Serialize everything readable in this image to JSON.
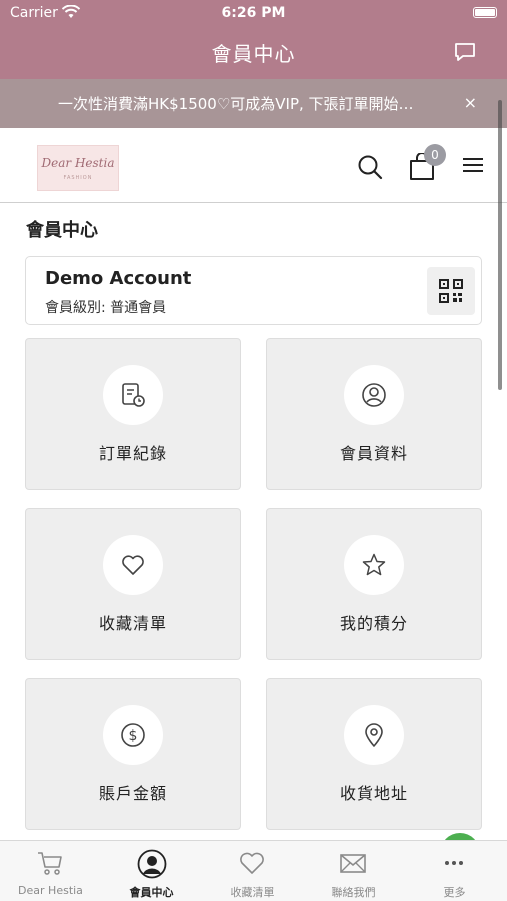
{
  "status_bar": {
    "carrier": "Carrier",
    "time": "6:26 PM"
  },
  "nav": {
    "title": "會員中心"
  },
  "announcement": {
    "text": "一次性消費滿HK$1500♡可成為VIP, 下張訂單開始…",
    "close": "×"
  },
  "header": {
    "logo_text": "Dear Hestia",
    "logo_sub": "FASHION",
    "cart_count": "0"
  },
  "page": {
    "title": "會員中心"
  },
  "account": {
    "name": "Demo Account",
    "level": "會員級別: 普通會員"
  },
  "tiles": [
    {
      "label": "訂單紀錄",
      "icon": "order-history-icon"
    },
    {
      "label": "會員資料",
      "icon": "user-profile-icon"
    },
    {
      "label": "收藏清單",
      "icon": "heart-icon"
    },
    {
      "label": "我的積分",
      "icon": "star-icon"
    },
    {
      "label": "賬戶金額",
      "icon": "dollar-icon"
    },
    {
      "label": "收貨地址",
      "icon": "location-pin-icon"
    }
  ],
  "tabbar": [
    {
      "label": "Dear Hestia",
      "icon": "cart-icon"
    },
    {
      "label": "會員中心",
      "icon": "member-icon",
      "active": true
    },
    {
      "label": "收藏清單",
      "icon": "heart-icon"
    },
    {
      "label": "聯絡我們",
      "icon": "mail-icon"
    },
    {
      "label": "更多",
      "icon": "more-icon"
    }
  ],
  "colors": {
    "brand": "#b27d8c",
    "banner": "#a89597",
    "tile_bg": "#eeeeee"
  }
}
